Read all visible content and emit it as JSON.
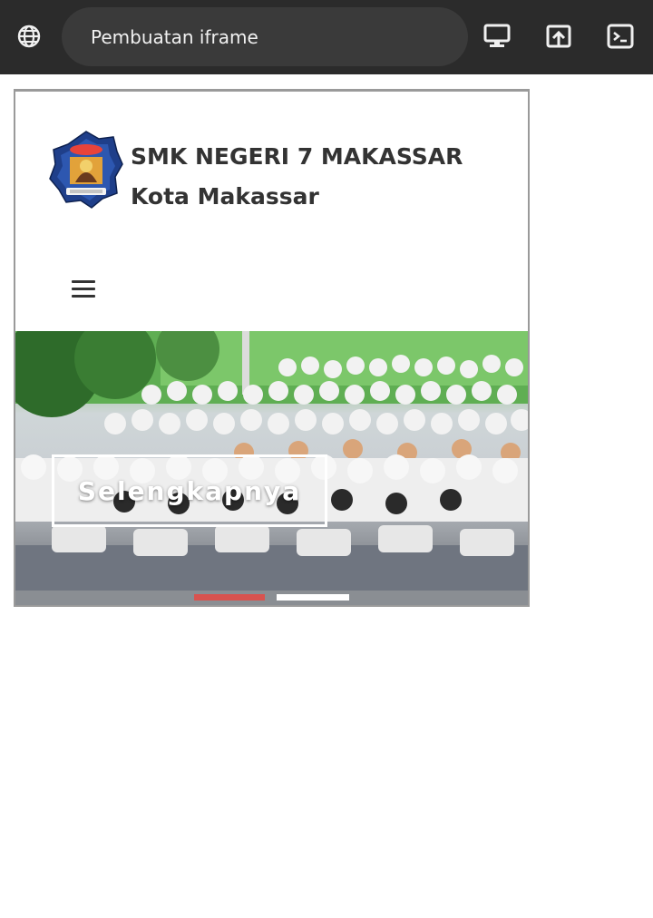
{
  "browser": {
    "url_title": "Pembuatan iframe",
    "icons": {
      "globe": "globe-icon",
      "desktop": "desktop-icon",
      "open": "open-in-new-icon",
      "console": "console-icon"
    }
  },
  "site": {
    "school_name": "SMK NEGERI 7 MAKASSAR",
    "city": "Kota Makassar",
    "menu_icon": "hamburger-menu-icon"
  },
  "hero": {
    "cta_label": "Selengkapnya",
    "slides": [
      {
        "active": true,
        "color": "#d9534f"
      },
      {
        "active": false,
        "color": "#ffffff"
      }
    ]
  },
  "colors": {
    "topbar": "#2b2b2b",
    "urlbox": "#3a3a3a",
    "text_dark": "#333333",
    "frame_border": "#9a9a9a"
  }
}
